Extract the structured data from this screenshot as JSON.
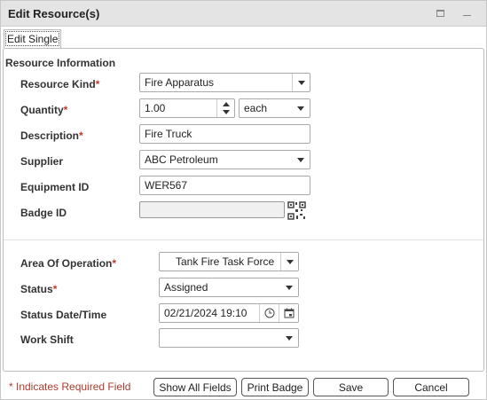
{
  "window": {
    "title": "Edit Resource(s)"
  },
  "tabs": [
    {
      "label": "Edit Single"
    }
  ],
  "resource_section": {
    "title": "Resource Information"
  },
  "required_marker": "*",
  "fields": {
    "resource_kind": {
      "label": "Resource Kind",
      "value": "Fire Apparatus",
      "required": true
    },
    "quantity": {
      "label": "Quantity",
      "value": "1.00",
      "unit": "each",
      "required": true
    },
    "description": {
      "label": "Description",
      "value": "Fire Truck",
      "required": true
    },
    "supplier": {
      "label": "Supplier",
      "value": "ABC Petroleum",
      "required": false
    },
    "equipment_id": {
      "label": "Equipment ID",
      "value": "WER567",
      "required": false
    },
    "badge_id": {
      "label": "Badge ID",
      "value": "",
      "required": false
    },
    "area_of_operation": {
      "label": "Area Of Operation",
      "value": "Tank Fire Task Force",
      "required": true
    },
    "status": {
      "label": "Status",
      "value": "Assigned",
      "required": true
    },
    "status_datetime": {
      "label": "Status Date/Time",
      "value": "02/21/2024 19:10",
      "required": false
    },
    "work_shift": {
      "label": "Work Shift",
      "value": "",
      "required": false
    }
  },
  "footer": {
    "required_note": "* Indicates Required Field",
    "show_all_fields": "Show All Fields",
    "print_badge": "Print Badge",
    "save": "Save",
    "cancel": "Cancel"
  },
  "icons": {
    "maximize": "maximize-icon",
    "minimize": "minimize-icon",
    "qr_code": "qr-code-icon",
    "clock": "clock-icon",
    "calendar": "calendar-icon"
  },
  "colors": {
    "required": "#c0392b",
    "titlebar": "#e4e4e4"
  }
}
